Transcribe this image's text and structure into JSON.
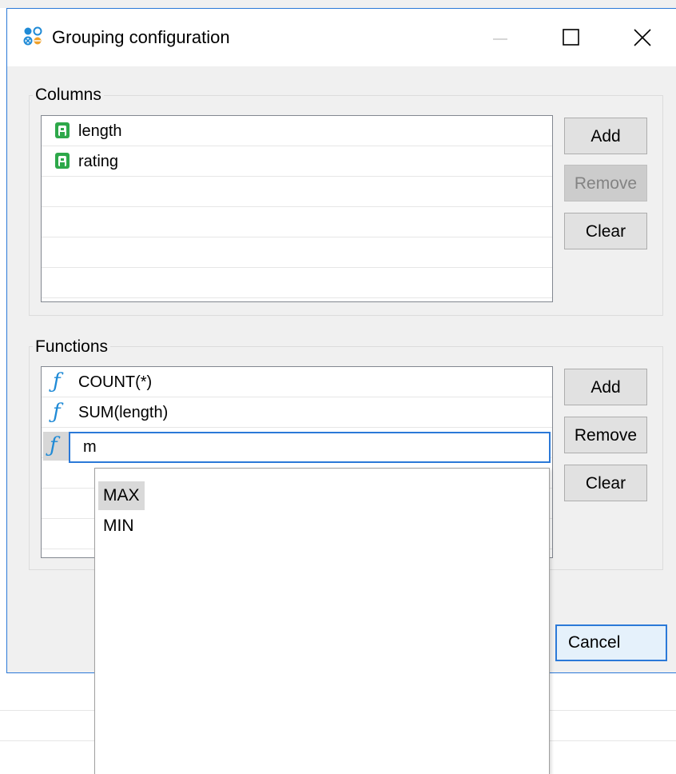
{
  "window": {
    "title": "Grouping configuration",
    "icon": "grouping-icon",
    "controls": {
      "minimize": "—",
      "maximize": "☐",
      "close": "✕"
    }
  },
  "columns": {
    "label": "Columns",
    "items": [
      {
        "text": "length",
        "icon": "attribute-icon"
      },
      {
        "text": "rating",
        "icon": "attribute-icon"
      }
    ],
    "buttons": {
      "add": "Add",
      "remove": "Remove",
      "clear": "Clear"
    },
    "remove_disabled": true
  },
  "functions": {
    "label": "Functions",
    "items": [
      {
        "text": "COUNT(*)",
        "icon": "function-icon"
      },
      {
        "text": "SUM(length)",
        "icon": "function-icon"
      }
    ],
    "editing_value": "m",
    "buttons": {
      "add": "Add",
      "remove": "Remove",
      "clear": "Clear"
    }
  },
  "autocomplete": {
    "options": [
      "MAX",
      "MIN"
    ],
    "selected": "MAX"
  },
  "footer": {
    "cancel": "Cancel"
  },
  "colors": {
    "accent": "#2b79d8",
    "attribute_icon": "#2ea84a",
    "function_icon": "#1f8ad6"
  }
}
